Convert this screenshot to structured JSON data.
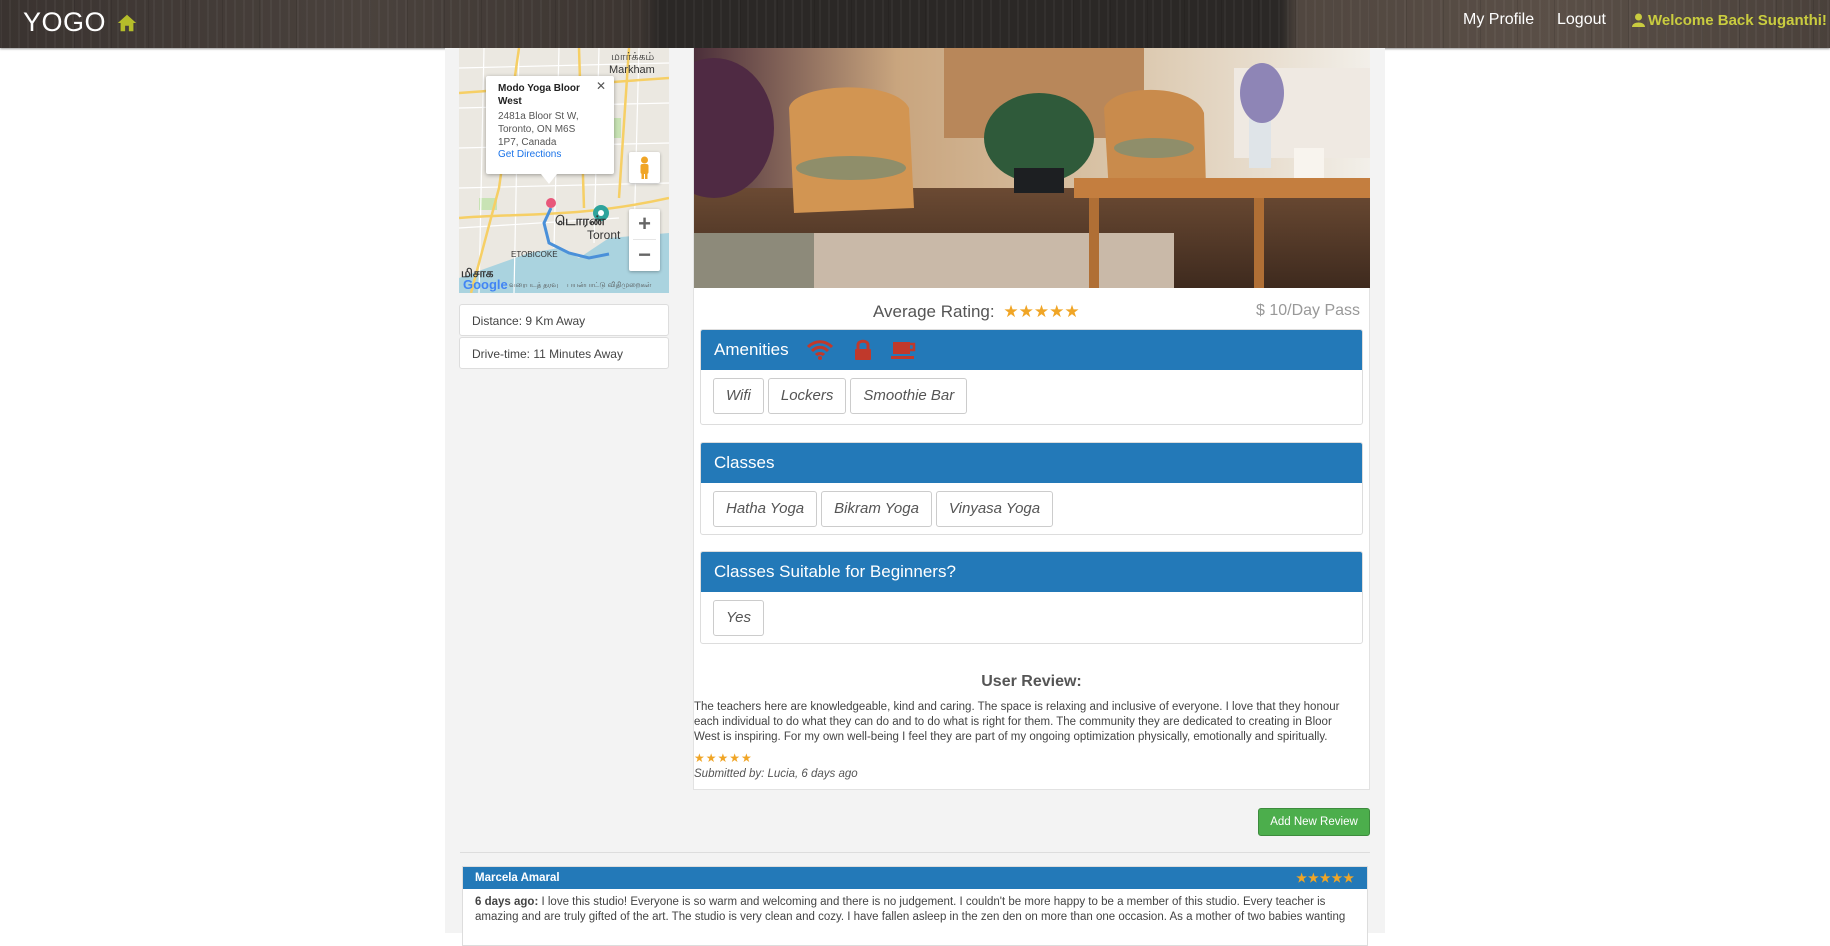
{
  "nav": {
    "brand": "YOGO",
    "my_profile": "My Profile",
    "logout": "Logout",
    "welcome": "Welcome Back Suganthi!"
  },
  "map": {
    "popup_title": "Modo Yoga Bloor West",
    "popup_address": "2481a Bloor St W, Toronto, ON M6S 1P7, Canada",
    "popup_directions": "Get Directions",
    "labels": {
      "markham": "மார்க்கம்",
      "markham_en": "Markham",
      "toronto_ta": "டொரண்",
      "toronto": "Toront",
      "etobicoke": "ETOBICOKE",
      "mississauga": "மிசாக",
      "google": "Google",
      "terms": "பயன்பாட்டு விதிமுறைகள்",
      "mapdata": "வரைபடத் தரவு"
    }
  },
  "sidebar": {
    "distance": "Distance: 9 Km Away",
    "drive_time": "Drive-time: 11 Minutes Away"
  },
  "studio": {
    "avg_rating_label": "Average Rating:",
    "avg_rating": 5,
    "price": "$ 10/Day Pass"
  },
  "amenities": {
    "title": "Amenities",
    "icons": [
      "wifi-icon",
      "lock-icon",
      "coffee-icon"
    ],
    "items": [
      "Wifi",
      "Lockers",
      "Smoothie Bar"
    ]
  },
  "classes": {
    "title": "Classes",
    "items": [
      "Hatha Yoga",
      "Bikram Yoga",
      "Vinyasa Yoga"
    ]
  },
  "beginners": {
    "title": "Classes Suitable for Beginners?",
    "items": [
      "Yes"
    ]
  },
  "user_review": {
    "title": "User Review:",
    "text": "The teachers here are knowledgeable, kind and caring. The space is relaxing and inclusive of everyone. I love that they honour each individual to do what they can do and to do what is right for them. The community they are dedicated to creating in Bloor West is inspiring. For my own well-being I feel they are part of my ongoing optimization physically, emotionally and spiritually.",
    "stars": "★★★★★",
    "submitted_by": "Submitted by: Lucia, 6 days ago"
  },
  "add_review_button": "Add New Review",
  "review_card": {
    "author": "Marcela Amaral",
    "stars": "★★★★★",
    "when": "6 days ago:",
    "text": " I love this studio! Everyone is so warm and welcoming and there is no judgement. I couldn't be more happy to be a member of this studio. Every teacher is amazing and are truly gifted of the art. The studio is very clean and cozy. I have fallen asleep in the zen den on more than one occasion. As a mother of two babies wanting"
  },
  "colors": {
    "section_blue": "#2379b8",
    "star_orange": "#f0a526",
    "welcome_yellow": "#c9cc3f",
    "amenity_icon_red": "#c0392b",
    "button_green": "#4cae4c"
  }
}
